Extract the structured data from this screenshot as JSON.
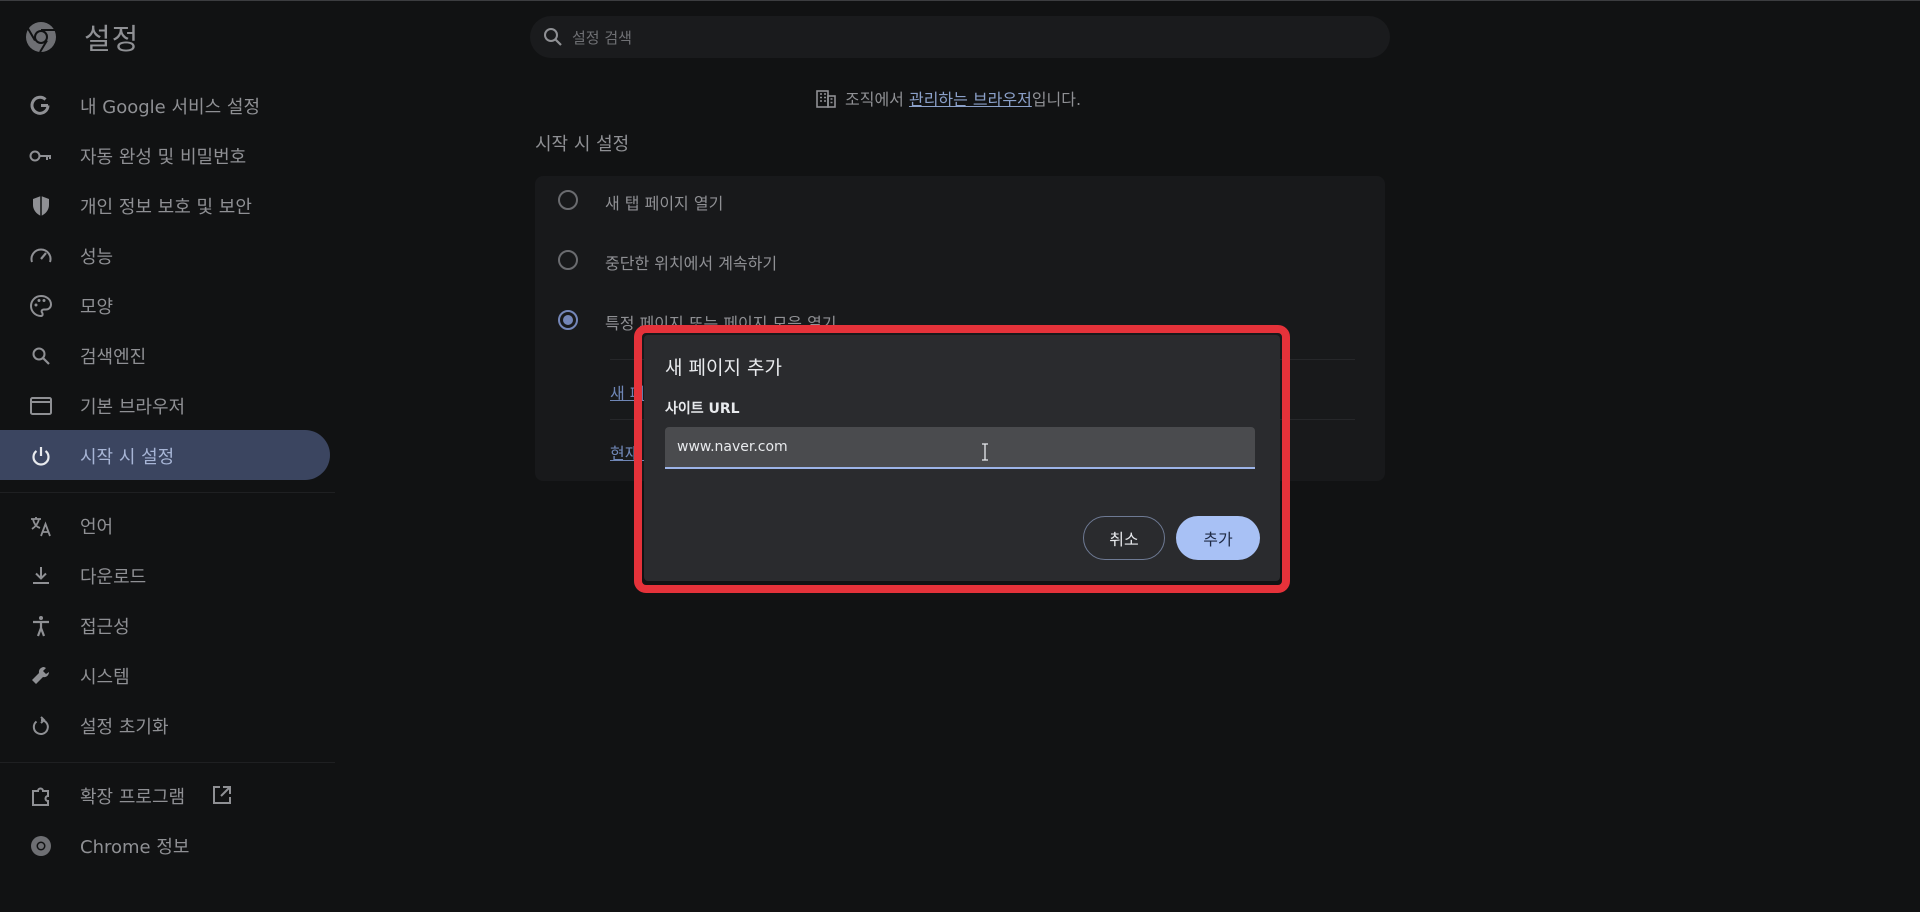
{
  "app": {
    "title": "설정"
  },
  "search": {
    "placeholder": "설정 검색"
  },
  "sidebar": {
    "items": [
      {
        "label": "내 Google 서비스 설정",
        "icon": "google-icon"
      },
      {
        "label": "자동 완성 및 비밀번호",
        "icon": "key-icon"
      },
      {
        "label": "개인 정보 보호 및 보안",
        "icon": "shield-icon"
      },
      {
        "label": "성능",
        "icon": "speedometer-icon"
      },
      {
        "label": "모양",
        "icon": "palette-icon"
      },
      {
        "label": "검색엔진",
        "icon": "search-icon"
      },
      {
        "label": "기본 브라우저",
        "icon": "browser-window-icon"
      },
      {
        "label": "시작 시 설정",
        "icon": "power-icon",
        "active": true
      },
      {
        "label": "언어",
        "icon": "translate-icon"
      },
      {
        "label": "다운로드",
        "icon": "download-icon"
      },
      {
        "label": "접근성",
        "icon": "accessibility-icon"
      },
      {
        "label": "시스템",
        "icon": "wrench-icon"
      },
      {
        "label": "설정 초기화",
        "icon": "reset-icon"
      },
      {
        "label": "확장 프로그램",
        "icon": "puzzle-icon"
      },
      {
        "label": "Chrome 정보",
        "icon": "chrome-icon"
      }
    ]
  },
  "managed": {
    "prefix": "조직에서 ",
    "link": "관리하는 브라우저",
    "suffix": "입니다."
  },
  "startup": {
    "section_title": "시작 시 설정",
    "options": [
      {
        "label": "새 탭 페이지 열기",
        "checked": false
      },
      {
        "label": "중단한 위치에서 계속하기",
        "checked": false
      },
      {
        "label": "특정 페이지 또는 페이지 모음 열기",
        "checked": true
      }
    ],
    "links": [
      "새 페이지 추가",
      "현재 페이지 사용"
    ]
  },
  "dialog": {
    "title": "새 페이지 추가",
    "url_label": "사이트 URL",
    "url_value": "www.naver.com",
    "cancel_label": "취소",
    "add_label": "추가",
    "highlight_color": "#e5323a"
  }
}
